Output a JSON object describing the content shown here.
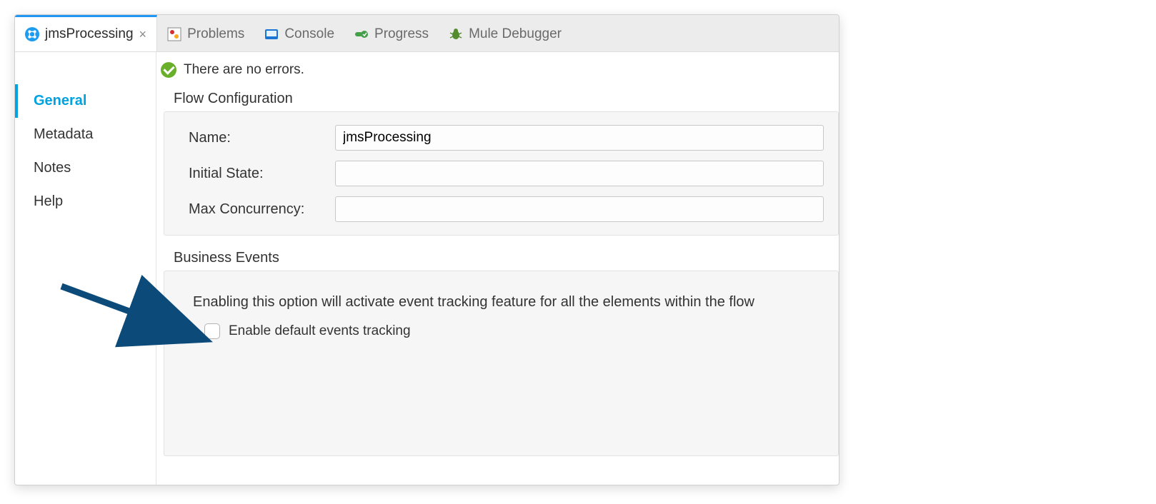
{
  "tabs": {
    "active": {
      "label": "jmsProcessing"
    },
    "others": [
      {
        "label": "Problems"
      },
      {
        "label": "Console"
      },
      {
        "label": "Progress"
      },
      {
        "label": "Mule Debugger"
      }
    ]
  },
  "status": {
    "message": "There are no errors."
  },
  "sidebar": {
    "items": [
      {
        "label": "General"
      },
      {
        "label": "Metadata"
      },
      {
        "label": "Notes"
      },
      {
        "label": "Help"
      }
    ]
  },
  "flowConfig": {
    "title": "Flow Configuration",
    "nameLabel": "Name:",
    "nameValue": "jmsProcessing",
    "initialStateLabel": "Initial State:",
    "initialStateValue": "",
    "maxConcurrencyLabel": "Max Concurrency:",
    "maxConcurrencyValue": ""
  },
  "businessEvents": {
    "title": "Business Events",
    "description": "Enabling this option will activate event tracking feature for all the elements within the flow",
    "checkboxLabel": "Enable default events tracking"
  }
}
